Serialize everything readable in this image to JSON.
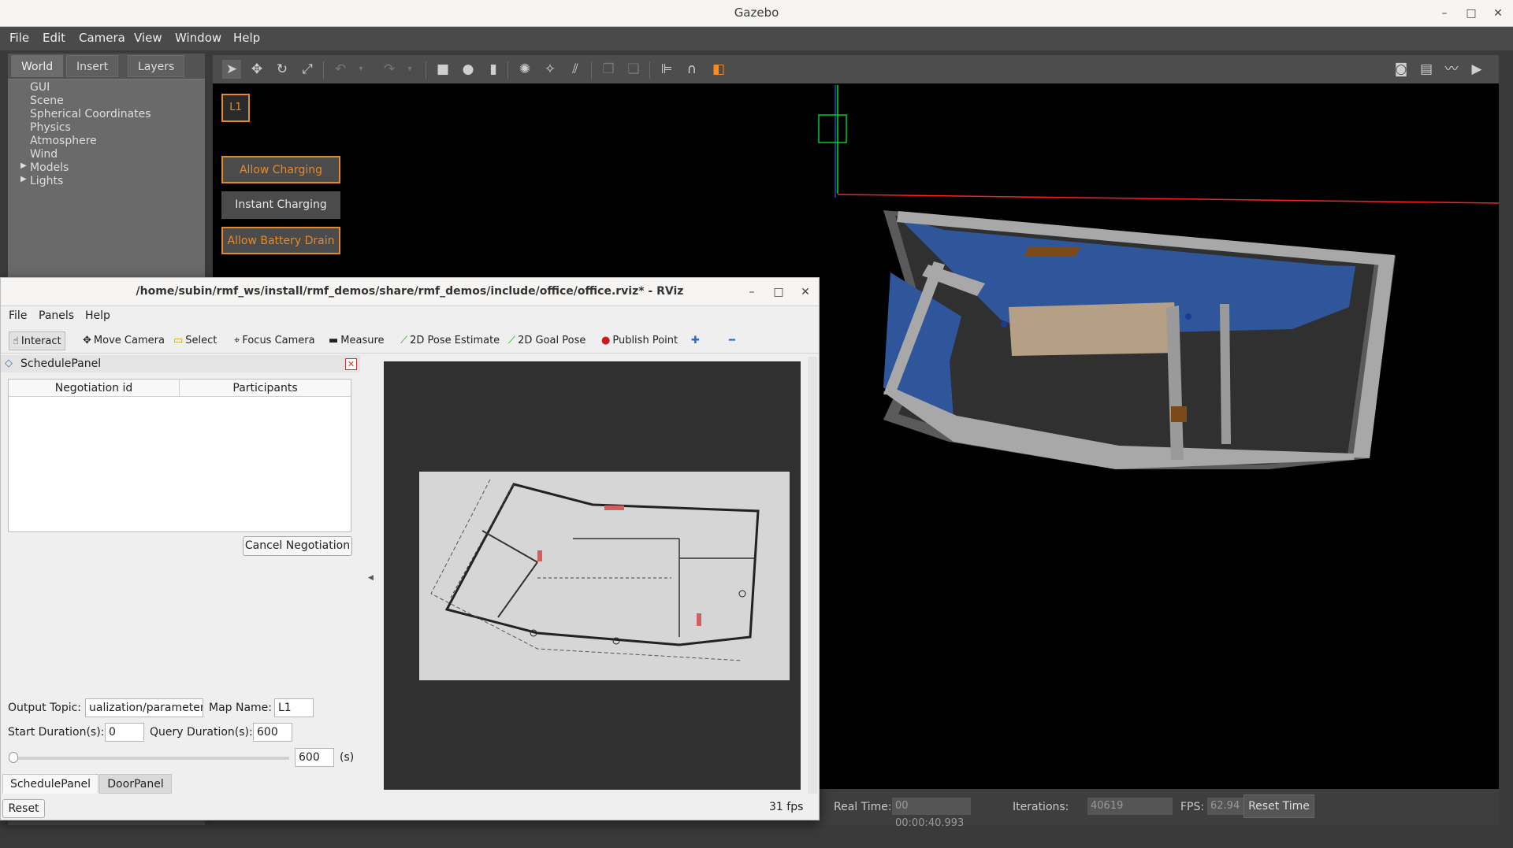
{
  "gazebo": {
    "title": "Gazebo",
    "window_controls": {
      "minimize": "–",
      "maximize": "□",
      "close": "✕"
    },
    "menu": [
      "File",
      "Edit",
      "Camera",
      "View",
      "Window",
      "Help"
    ],
    "left_tabs": [
      "World",
      "Insert",
      "Layers"
    ],
    "world_tree": [
      "GUI",
      "Scene",
      "Spherical Coordinates",
      "Physics",
      "Atmosphere",
      "Wind",
      "Models",
      "Lights"
    ],
    "toolbar_icons": [
      "select-arrow-icon",
      "translate-icon",
      "rotate-icon",
      "scale-icon",
      "undo-icon",
      "undo-dropdown-icon",
      "redo-icon",
      "redo-dropdown-icon",
      "box-icon",
      "sphere-icon",
      "cylinder-icon",
      "point-light-icon",
      "spot-light-icon",
      "directional-light-icon",
      "copy-icon",
      "paste-icon",
      "align-icon",
      "snap-magnet-icon",
      "view-angle-icon"
    ],
    "toolbar_right_icons": [
      "screenshot-icon",
      "log-icon",
      "plot-icon",
      "video-record-icon"
    ],
    "overlay": {
      "level": "L1",
      "allow_charging": "Allow Charging",
      "instant_charging": "Instant Charging",
      "allow_battery_drain": "Allow Battery Drain"
    },
    "status": {
      "real_time_label": "Real Time:",
      "real_time_value": "00 00:00:40.993",
      "iterations_label": "Iterations:",
      "iterations_value": "40619",
      "fps_label": "FPS:",
      "fps_value": "62.94",
      "reset_time": "Reset Time"
    }
  },
  "rviz": {
    "title": "/home/subin/rmf_ws/install/rmf_demos/share/rmf_demos/include/office/office.rviz* - RViz",
    "window_controls": {
      "minimize": "–",
      "maximize": "□",
      "close": "✕"
    },
    "menu": [
      "File",
      "Panels",
      "Help"
    ],
    "tools": {
      "interact": "Interact",
      "move_camera": "Move Camera",
      "select": "Select",
      "focus_camera": "Focus Camera",
      "measure": "Measure",
      "pose_estimate": "2D Pose Estimate",
      "goal_pose": "2D Goal Pose",
      "publish_point": "Publish Point",
      "plus": "✚",
      "minus": "━"
    },
    "schedule_panel": {
      "title": "SchedulePanel",
      "columns": [
        "Negotiation id",
        "Participants"
      ],
      "rows": [],
      "cancel_button": "Cancel Negotiation",
      "output_topic_label": "Output Topic:",
      "output_topic_value": "ualization/parameters",
      "map_name_label": "Map Name:",
      "map_name_value": "L1",
      "start_duration_label": "Start Duration(s):",
      "start_duration_value": "0",
      "query_duration_label": "Query Duration(s):",
      "query_duration_value": "600",
      "slider_value": "600",
      "slider_unit": "(s)",
      "slider_fraction": 0.0
    },
    "bottom_tabs": [
      "SchedulePanel",
      "DoorPanel"
    ],
    "reset_button": "Reset",
    "fps": "31 fps"
  }
}
